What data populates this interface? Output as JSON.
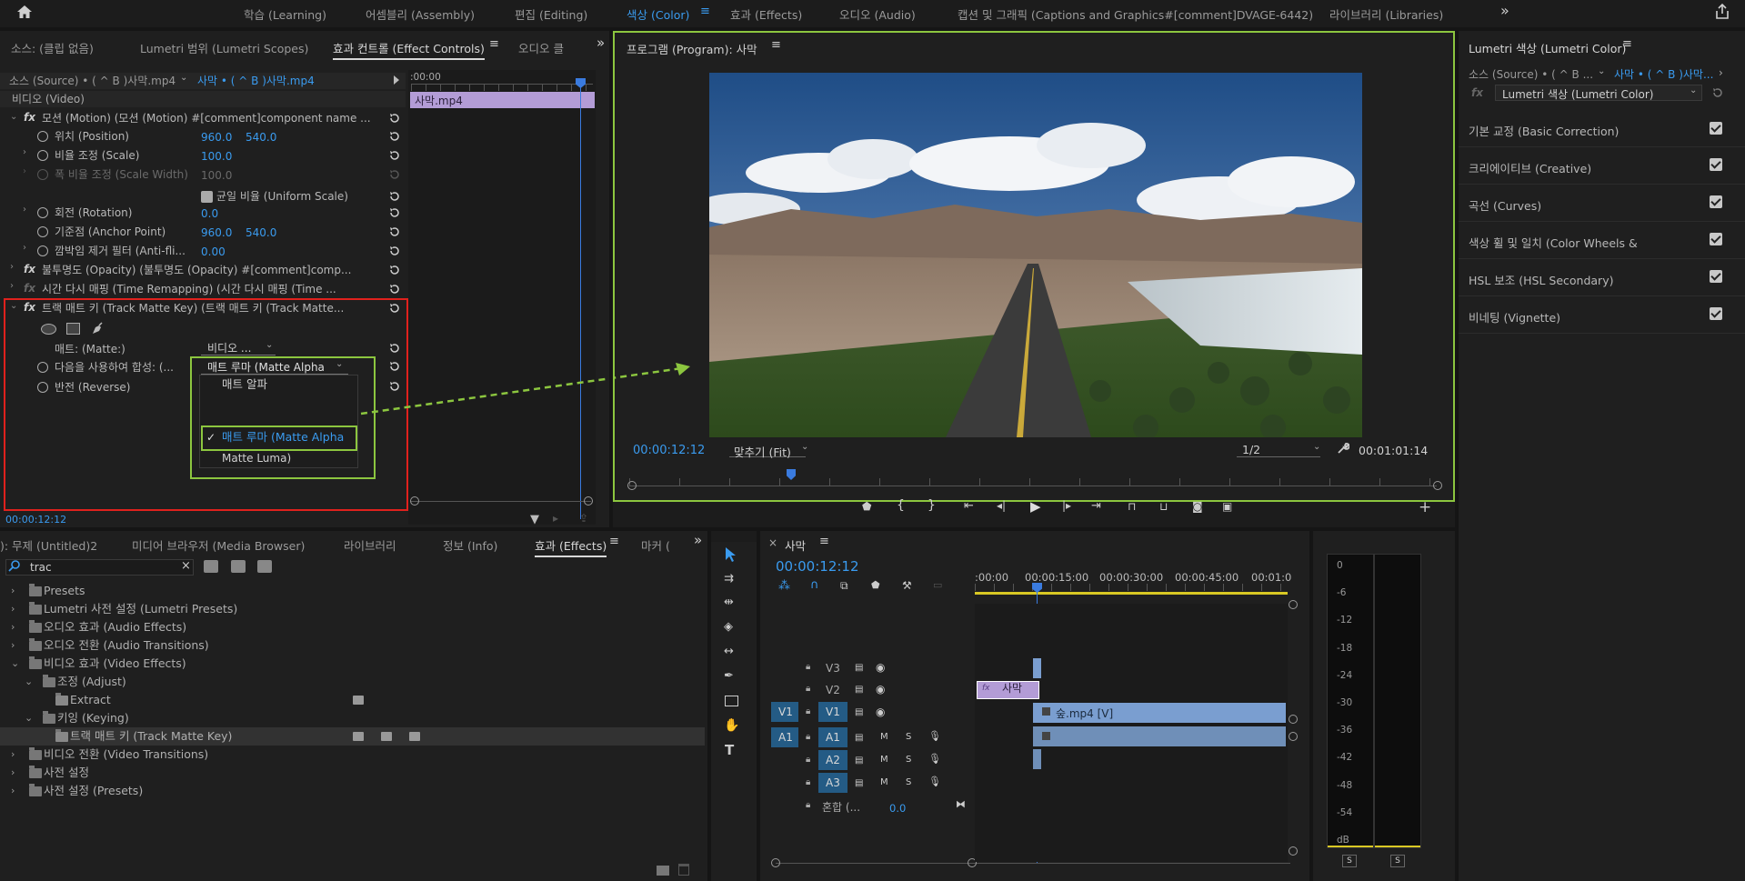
{
  "topbar": {
    "tabs": [
      "학습 (Learning)",
      "어셈블리 (Assembly)",
      "편집 (Editing)",
      "색상 (Color)",
      "효과 (Effects)",
      "오디오 (Audio)",
      "캡션 및 그래픽 (Captions and Graphics#[comment]DVAGE-6442)",
      "라이브러리 (Libraries)"
    ],
    "active_tab": "색상 (Color)",
    "more": "»"
  },
  "left_panel": {
    "tabs": [
      "소스: (클립 없음)",
      "Lumetri 범위 (Lumetri Scopes)",
      "효과 컨트롤 (Effect Controls)",
      "오디오 클"
    ],
    "active_tab": "효과 컨트롤 (Effect Controls)",
    "source_label": "소스 (Source) • ( ^ B )사막.mp4",
    "sequence_label": "사막 • ( ^ B )사막.mp4",
    "timeline_time": ":00:00",
    "clip_name": "사막.mp4",
    "video_header": "비디오 (Video)",
    "motion": "모션 (Motion)   (모션 (Motion)   #[comment]component name ...",
    "position_label": "위치 (Position)",
    "position_x": "960.0",
    "position_y": "540.0",
    "scale_label": "비율 조정 (Scale)",
    "scale_value": "100.0",
    "scale_width_label": "폭 비율 조정 (Scale Width)",
    "scale_width_value": "100.0",
    "uniform_scale": "균일 비율 (Uniform Scale)",
    "rotation_label": "회전 (Rotation)",
    "rotation_value": "0.0",
    "anchor_label": "기준점 (Anchor Point)",
    "anchor_x": "960.0",
    "anchor_y": "540.0",
    "antiflicker_label": "깜박임 제거 필터 (Anti-fli...",
    "antiflicker_value": "0.00",
    "opacity": "불투명도 (Opacity)   (불투명도 (Opacity)   #[comment]comp...",
    "time_remap": "시간 다시 매핑 (Time Remapping)   (시간 다시 매핑 (Time ...",
    "track_matte": "트랙 매트 키 (Track Matte Key)   (트랙 매트 키 (Track Matte...",
    "matte_label": "매트: (Matte:)",
    "matte_value": "비디오 ...",
    "composite_label": "다음을 사용하여 합성: (...",
    "composite_value": "매트 루마 (Matte Alpha",
    "reverse_label": "반전 (Reverse)",
    "dropdown_items": [
      "매트 알파",
      "매트 루마 (Matte Alpha",
      "Matte Luma)"
    ],
    "timecode": "00:00:12:12"
  },
  "program": {
    "title": "프로그램 (Program): 사막",
    "timecode": "00:00:12:12",
    "fit": "맞추기 (Fit)",
    "resolution": "1/2",
    "duration": "00:01:01:14"
  },
  "lumetri": {
    "title": "Lumetri 색상 (Lumetri Color)",
    "source": "소스 (Source) • ( ^ B ...",
    "sequence": "사막 • ( ^ B )사막...",
    "effect": "Lumetri 색상 (Lumetri Color)",
    "sections": [
      "기본 교정 (Basic Correction)",
      "크리에이티브 (Creative)",
      "곡선 (Curves)",
      "색상 휠 및 일치 (Color Wheels &",
      "HSL 보조 (HSL Secondary)",
      "비네팅 (Vignette)"
    ]
  },
  "project": {
    "tabs": [
      "): 무제 (Untitled)2",
      "미디어 브라우저 (Media Browser)",
      "라이브러리",
      "정보 (Info)",
      "효과 (Effects)",
      "마커 ("
    ],
    "active_tab": "효과 (Effects)",
    "search": "trac",
    "items": [
      {
        "label": "Presets",
        "level": 0,
        "open": false
      },
      {
        "label": "Lumetri 사전 설정 (Lumetri Presets)",
        "level": 0,
        "open": false
      },
      {
        "label": "오디오 효과 (Audio Effects)",
        "level": 0,
        "open": false
      },
      {
        "label": "오디오 전환 (Audio Transitions)",
        "level": 0,
        "open": false
      },
      {
        "label": "비디오 효과 (Video Effects)",
        "level": 0,
        "open": true
      },
      {
        "label": "조정 (Adjust)",
        "level": 1,
        "open": true
      },
      {
        "label": "Extract",
        "level": 2,
        "open": false
      },
      {
        "label": "키잉 (Keying)",
        "level": 1,
        "open": true
      },
      {
        "label": "트랙 매트 키 (Track Matte Key)",
        "level": 2,
        "open": false
      },
      {
        "label": "비디오 전환 (Video Transitions)",
        "level": 0,
        "open": false
      },
      {
        "label": "사전 설정",
        "level": 0,
        "open": false
      },
      {
        "label": "사전 설정 (Presets)",
        "level": 0,
        "open": false
      }
    ]
  },
  "timeline": {
    "sequence": "사막",
    "timecode": "00:00:12:12",
    "ruler": [
      ":00:00",
      "00:00:15:00",
      "00:00:30:00",
      "00:00:45:00",
      "00:01:0"
    ],
    "tracks": [
      "V3",
      "V2",
      "V1",
      "A1",
      "A2",
      "A3"
    ],
    "mix_label": "혼합 (...",
    "mix_value": "0.0",
    "clip_v2": "사막",
    "clip_v1": "숲.mp4 [V]",
    "src_v1": "V1",
    "src_a1": "A1",
    "M": "M",
    "S": "S",
    "fx": "fx"
  },
  "meter": {
    "labels": [
      "0",
      "-6",
      "-12",
      "-18",
      "-24",
      "-30",
      "-36",
      "-42",
      "-48",
      "-54",
      "dB"
    ],
    "solo": "S"
  }
}
